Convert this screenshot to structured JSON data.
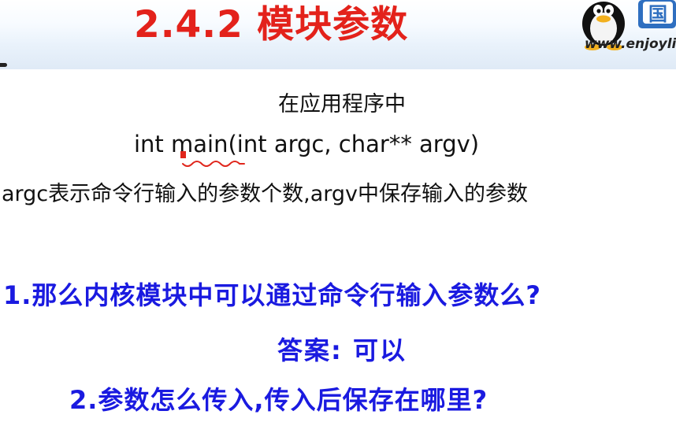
{
  "header": {
    "title": "2.4.2 模块参数",
    "website": "www.enjoyli",
    "colors": {
      "title": "#e3221b",
      "band_top": "#ffffff",
      "band_bottom": "#dfeaf6"
    },
    "logo_icon": "tux-penguin-icon",
    "logo_badge_text": "国"
  },
  "body": {
    "context_line": "在应用程序中",
    "code_line": "int main(int argc, char** argv)",
    "description_line": "argc表示命令行输入的参数个数,argv中保存输入的参数",
    "annotation_color": "#e0261c",
    "body_text_color": "#111111"
  },
  "qa": {
    "question1": "1.那么内核模块中可以通过命令行输入参数么?",
    "answer": "答案: 可以",
    "question2": "2.参数怎么传入,传入后保存在哪里?",
    "color": "#1a1ae0"
  }
}
